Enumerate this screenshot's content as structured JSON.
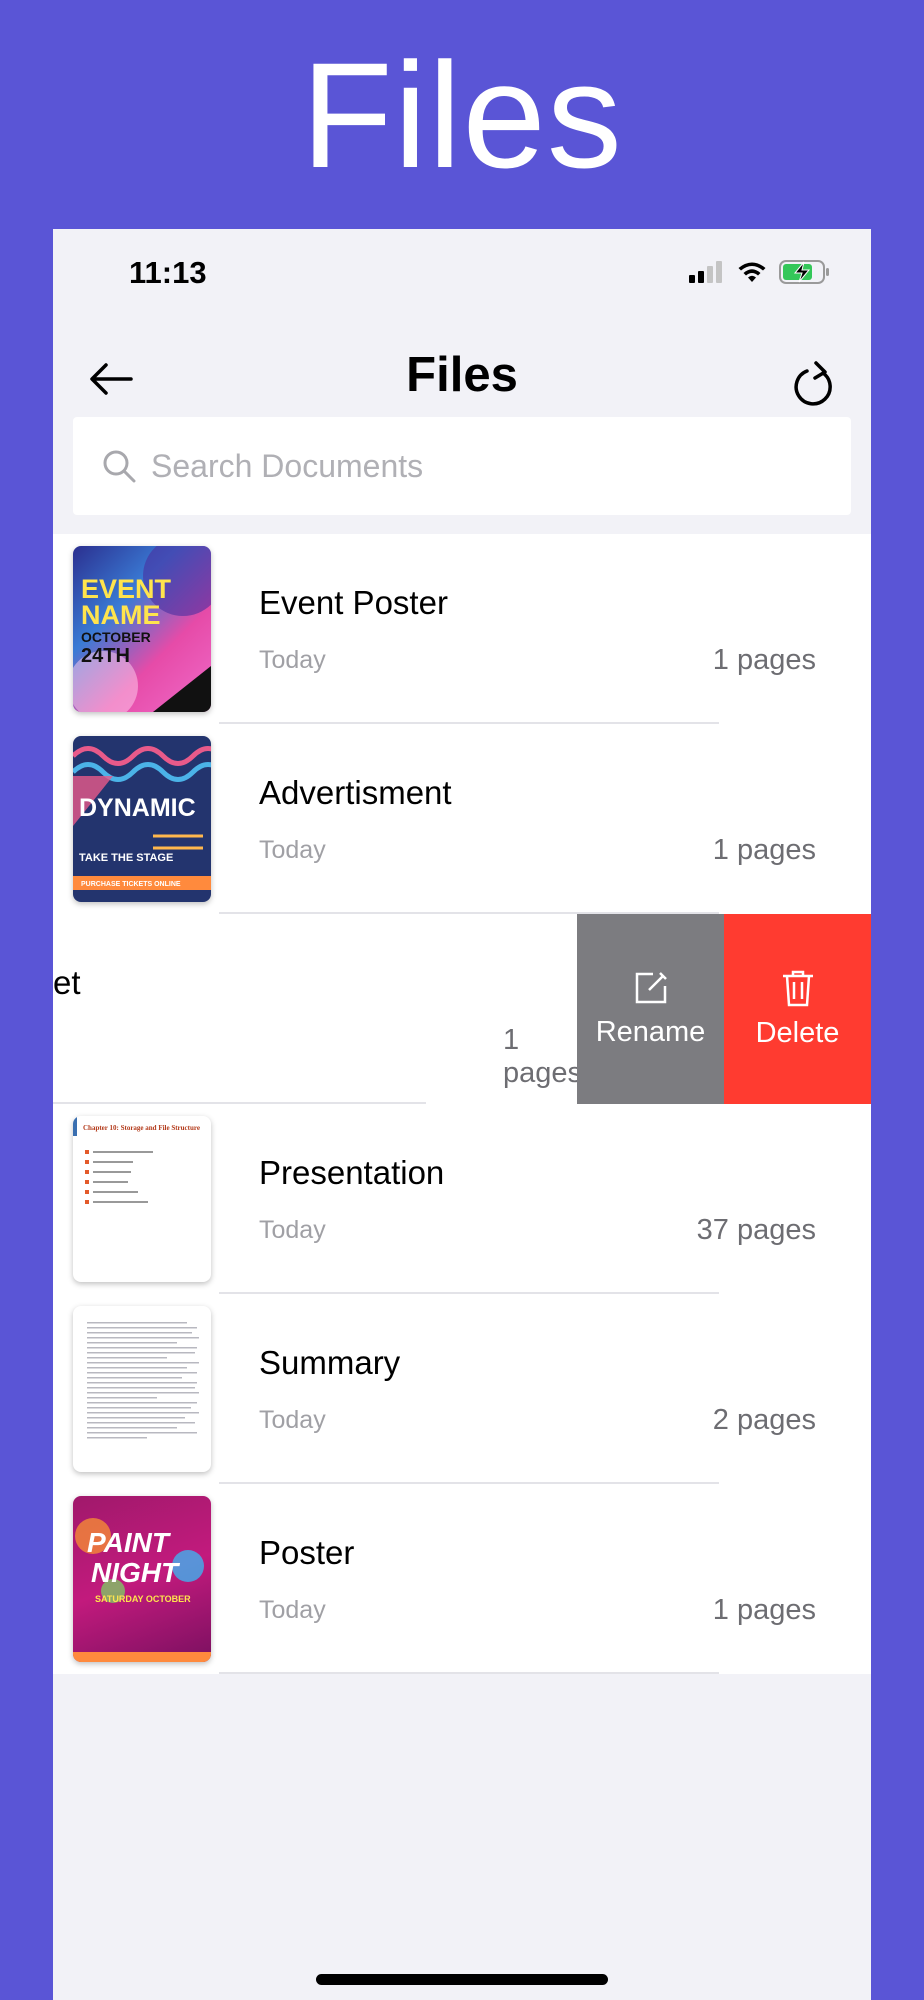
{
  "banner": {
    "title": "Files"
  },
  "status_bar": {
    "time": "11:13"
  },
  "nav": {
    "title": "Files"
  },
  "search": {
    "placeholder": "Search Documents"
  },
  "files": [
    {
      "name": "Event Poster",
      "date": "Today",
      "pages": "1 pages"
    },
    {
      "name": "Advertisment",
      "date": "Today",
      "pages": "1 pages"
    },
    {
      "name": "et",
      "date": "",
      "pages": "1 pages"
    },
    {
      "name": "Presentation",
      "date": "Today",
      "pages": "37 pages"
    },
    {
      "name": "Summary",
      "date": "Today",
      "pages": "2 pages"
    },
    {
      "name": "Poster",
      "date": "Today",
      "pages": "1 pages"
    }
  ],
  "swipe_actions": {
    "rename_label": "Rename",
    "delete_label": "Delete"
  },
  "thumbnails": {
    "event": {
      "line1": "EVENT",
      "line2": "NAME",
      "line3": "OCTOBER",
      "line4": "24TH"
    },
    "ad": {
      "line1": "DYNAMIC",
      "line2": "TAKE THE STAGE",
      "line3": "PURCHASE TICKETS ONLINE"
    },
    "presentation": {
      "title": "Chapter 10: Storage and File Structure"
    },
    "poster": {
      "line1": "PAINT",
      "line2": "NIGHT",
      "line3": "SATURDAY OCTOBER"
    }
  },
  "colors": {
    "accent": "#5a55d6",
    "delete": "#ff3b30",
    "rename": "#7c7c80"
  }
}
